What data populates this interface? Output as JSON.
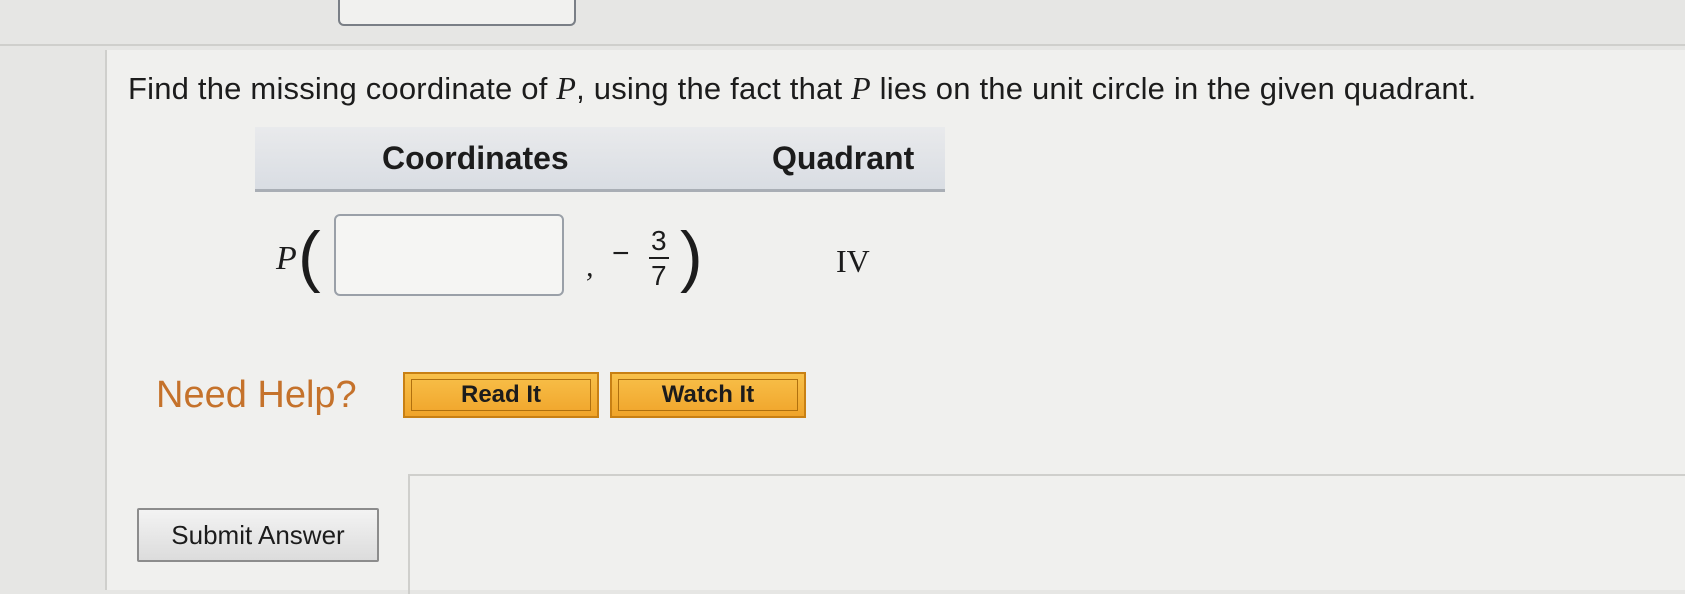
{
  "question": {
    "prefix": "Find the missing coordinate of ",
    "var1": "P",
    "middle": ", using the fact that ",
    "var2": "P",
    "suffix": " lies on the unit circle in the given quadrant."
  },
  "table": {
    "headers": [
      "Coordinates",
      "Quadrant"
    ],
    "row": {
      "point_label": "P",
      "open_paren": "(",
      "answer_value": "",
      "comma": ",",
      "sign": "−",
      "numerator": "3",
      "denominator": "7",
      "close_paren": ")",
      "quadrant": "IV"
    }
  },
  "help": {
    "label": "Need Help?",
    "buttons": [
      "Read It",
      "Watch It"
    ]
  },
  "submit": {
    "label": "Submit Answer"
  },
  "colors": {
    "help_text": "#c5722b",
    "help_button": "#f0a42a",
    "header_bg": "#d9dde3"
  }
}
